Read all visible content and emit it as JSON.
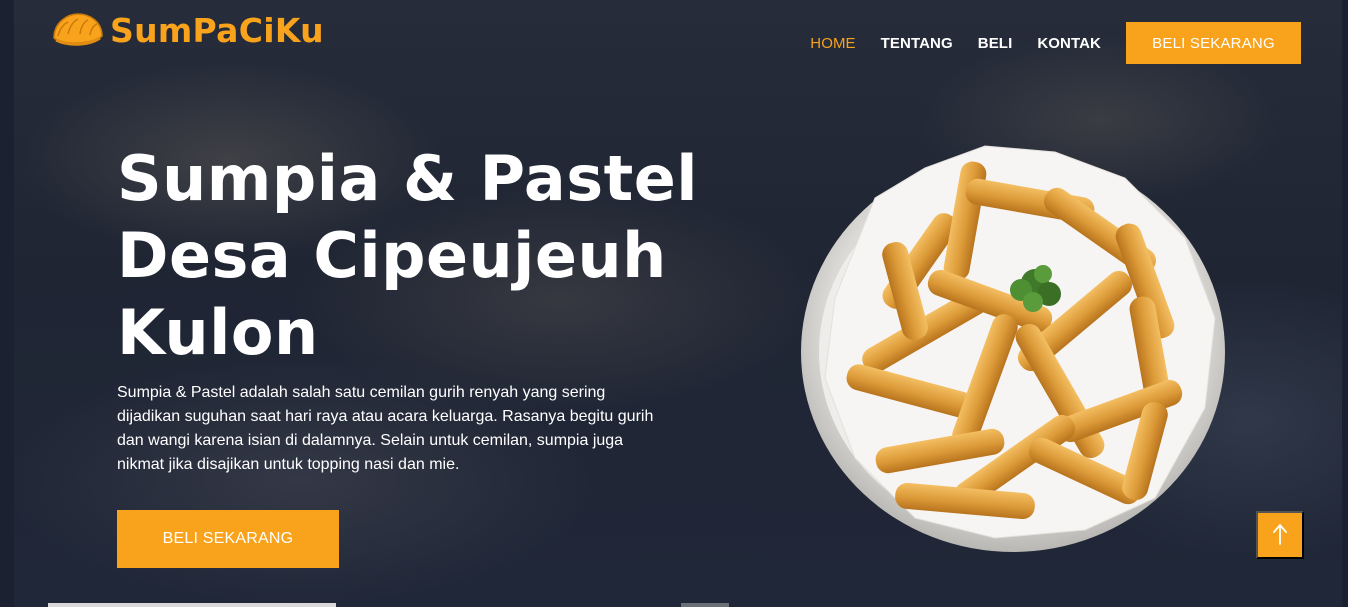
{
  "brand": {
    "name": "SumPaCiKu",
    "logo_icon": "pastel-icon",
    "color": "#f9a21b"
  },
  "nav": {
    "items": [
      {
        "label": "HOME",
        "active": true
      },
      {
        "label": "TENTANG",
        "active": false
      },
      {
        "label": "BELI",
        "active": false
      },
      {
        "label": "KONTAK",
        "active": false
      }
    ],
    "cta_label": "BELI SEKARANG"
  },
  "hero": {
    "title_lines": [
      "Sumpia & Pastel",
      "Desa Cipeujeuh",
      "Kulon"
    ],
    "description": "Sumpia & Pastel adalah salah satu cemilan gurih renyah yang sering dijadikan suguhan saat hari raya atau acara keluarga. Rasanya begitu gurih dan wangi karena isian di dalamnya. Selain untuk cemilan, sumpia juga nikmat jika disajikan untuk topping nasi dan mie.",
    "cta_label": "BELI SEKARANG",
    "image_icon": "sumpia-bowl-image"
  },
  "scroll_top": {
    "icon": "arrow-up-icon"
  },
  "colors": {
    "accent": "#f9a21b",
    "background": "#1e2533",
    "text": "#ffffff"
  }
}
